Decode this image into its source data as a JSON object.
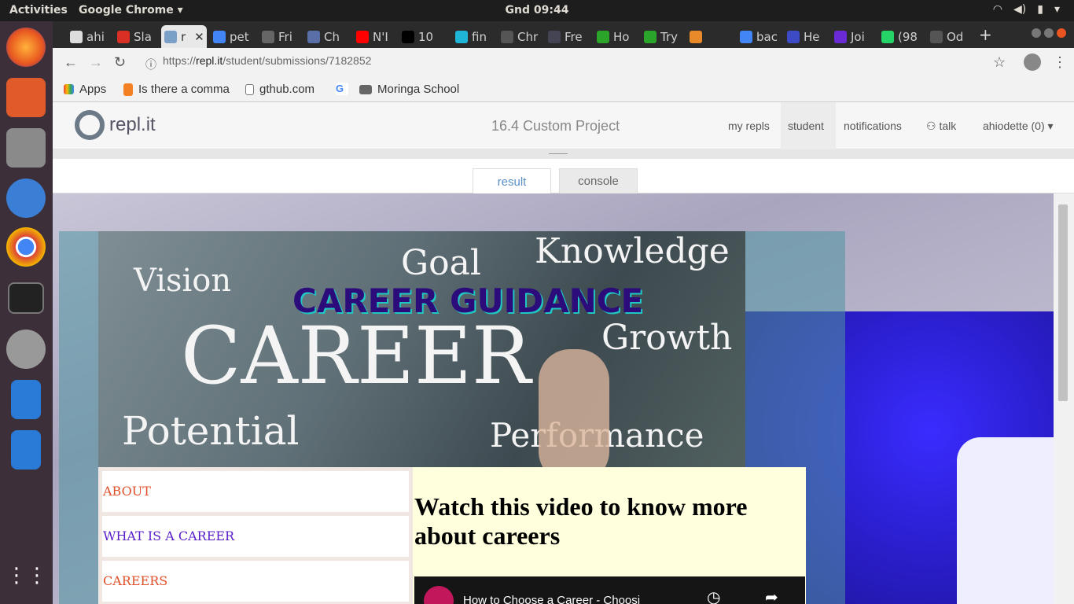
{
  "topbar": {
    "activities": "Activities",
    "app": "Google Chrome ▾",
    "clock": "Gnd 09:44"
  },
  "tabs": [
    {
      "label": "ahi",
      "fav": "#ddd"
    },
    {
      "label": "Sla",
      "fav": "#d93025"
    },
    {
      "label": "r",
      "fav": "#7aa0c7"
    },
    {
      "label": "pet",
      "fav": "#4285f4"
    },
    {
      "label": "Fri",
      "fav": "#666"
    },
    {
      "label": "Ch",
      "fav": "#5a6fa8"
    },
    {
      "label": "N'I",
      "fav": "#ff0000"
    },
    {
      "label": "10",
      "fav": "#000"
    },
    {
      "label": "fin",
      "fav": "#1fb5d6"
    },
    {
      "label": "Chr",
      "fav": "#555"
    },
    {
      "label": "Fre",
      "fav": "#445"
    },
    {
      "label": "Ho",
      "fav": "#2aa52a"
    },
    {
      "label": "Try",
      "fav": "#2aa52a"
    },
    {
      "label": "",
      "fav": "#e88a2a"
    },
    {
      "label": "bac",
      "fav": "#4285f4"
    },
    {
      "label": "He",
      "fav": "#3d4cc6"
    },
    {
      "label": "Joi",
      "fav": "#6a2ad6"
    },
    {
      "label": "(98",
      "fav": "#25d366"
    },
    {
      "label": "Od",
      "fav": "#555"
    }
  ],
  "toolbar": {
    "url_prefix": "https://",
    "url_host": "repl.it",
    "url_path": "/student/submissions/7182852"
  },
  "bookmarks": {
    "apps": "Apps",
    "b1": "Is there a comma",
    "b2": "gthub.com",
    "b3": "",
    "b4": "Moringa School"
  },
  "replit": {
    "logo": "repl.it",
    "project_title": "16.4 Custom Project",
    "nav": {
      "my_repls": "my repls",
      "student": "student",
      "notifications": "notifications",
      "talk": "talk",
      "user": "ahiodette (0)"
    }
  },
  "panel_tabs": {
    "result": "result",
    "console": "console"
  },
  "page": {
    "banner_words": {
      "vision": "Vision",
      "goal": "Goal",
      "knowledge": "Knowledge",
      "career": "CAREER",
      "growth": "Growth",
      "potential": "Potential",
      "performance": "Performance"
    },
    "headline": "CAREER GUIDANCE",
    "nav": [
      {
        "label": "ABOUT",
        "color": "#e0502a"
      },
      {
        "label": "WHAT IS A CAREER",
        "color": "#5a1ec8"
      },
      {
        "label": "CAREERS",
        "color": "#e0502a"
      }
    ],
    "video_heading": "Watch this video to know more about careers",
    "video_title": "How to Choose a Career - Choosi"
  }
}
